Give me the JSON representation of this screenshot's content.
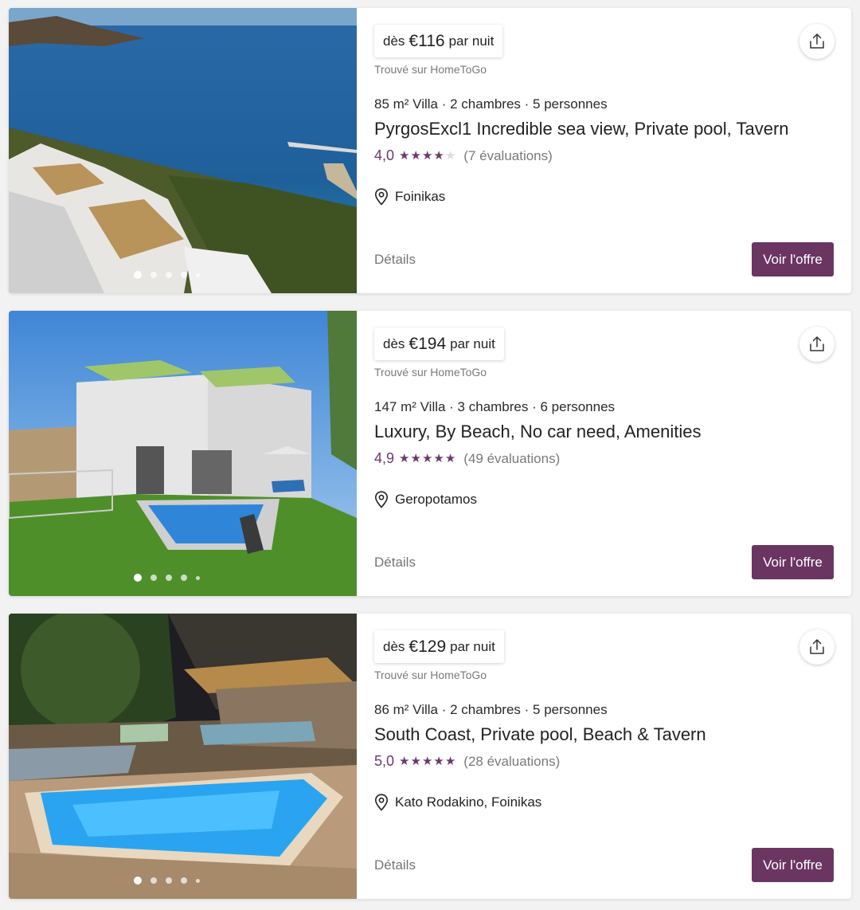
{
  "listings": [
    {
      "price_from": "dès",
      "price_amount": "€116",
      "price_unit": "par nuit",
      "source": "Trouvé sur HomeToGo",
      "specs": "85 m² Villa · 2 chambres · 5 personnes",
      "title": "PyrgosExcl1 Incredible sea view, Private pool, Tavern",
      "rating": "4,0",
      "stars": 4,
      "reviews": "(7 évaluations)",
      "location": "Foinikas",
      "details_label": "Détails",
      "offer_label": "Voir l'offre"
    },
    {
      "price_from": "dès",
      "price_amount": "€194",
      "price_unit": "par nuit",
      "source": "Trouvé sur HomeToGo",
      "specs": "147 m² Villa · 3 chambres · 6 personnes",
      "title": "Luxury, By Beach, No car need, Amenities",
      "rating": "4,9",
      "stars": 5,
      "reviews": "(49 évaluations)",
      "location": "Geropotamos",
      "details_label": "Détails",
      "offer_label": "Voir l'offre"
    },
    {
      "price_from": "dès",
      "price_amount": "€129",
      "price_unit": "par nuit",
      "source": "Trouvé sur HomeToGo",
      "specs": "86 m² Villa · 2 chambres · 5 personnes",
      "title": "South Coast, Private pool, Beach & Tavern",
      "rating": "5,0",
      "stars": 5,
      "reviews": "(28 évaluations)",
      "location": "Kato Rodakino, Foinikas",
      "details_label": "Détails",
      "offer_label": "Voir l'offre"
    }
  ],
  "colors": {
    "accent": "#6b3562",
    "rating": "#6b3a6b",
    "muted_text": "#7a7a7a"
  },
  "icons": {
    "share": "share-upload-icon",
    "location": "map-pin-icon",
    "star": "star-icon"
  }
}
